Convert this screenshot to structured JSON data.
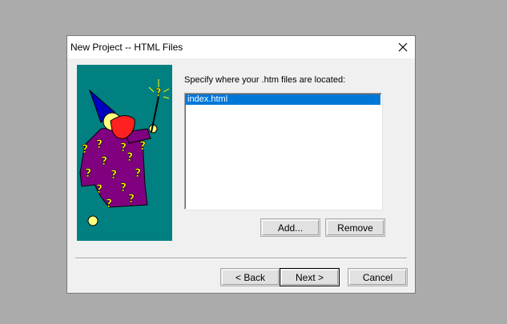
{
  "window": {
    "title": "New Project -- HTML Files",
    "close_icon": "close-icon"
  },
  "wizard": {
    "image": "wizard-illustration",
    "background": "#008080"
  },
  "files_section": {
    "prompt": "Specify where your .htm files are located:",
    "files": [
      "index.html"
    ],
    "selected_index": 0,
    "selection_color": "#0078d7"
  },
  "file_buttons": {
    "add": "Add...",
    "remove": "Remove"
  },
  "nav_buttons": {
    "back": "< Back",
    "next": "Next >",
    "cancel": "Cancel"
  }
}
